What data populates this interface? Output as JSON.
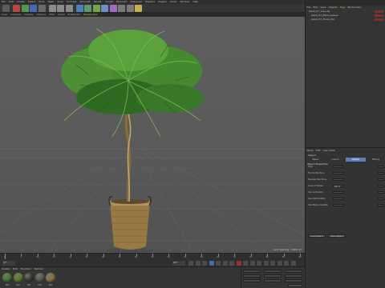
{
  "menubar": {
    "items": [
      "File",
      "Edit",
      "Create",
      "Select",
      "Tools",
      "Mesh",
      "Snap",
      "Animate",
      "Simulate",
      "Render",
      "Sculpt",
      "MoGraph",
      "Character",
      "Pipeline",
      "Plugins",
      "Script",
      "Window",
      "Help"
    ]
  },
  "toolbar": {
    "buttons": [
      {
        "name": "undo-icon",
        "color": "#5c5c5c"
      },
      {
        "name": "x-axis-icon",
        "color": "#b54747"
      },
      {
        "name": "y-axis-icon",
        "color": "#4f9a4f"
      },
      {
        "name": "z-axis-icon",
        "color": "#4768b5"
      },
      {
        "name": "coord-system-icon",
        "color": "#6a6a6a"
      },
      {
        "name": "render-view-icon",
        "color": "#8a8a8a"
      },
      {
        "name": "render-picture-viewer-icon",
        "color": "#8a8a8a"
      },
      {
        "name": "render-settings-icon",
        "color": "#8a8a8a"
      },
      {
        "name": "cube-icon",
        "color": "#4a7ec2"
      },
      {
        "name": "pen-icon",
        "color": "#5a9a6a"
      },
      {
        "name": "subdivision-icon",
        "color": "#7aa24c"
      },
      {
        "name": "array-icon",
        "color": "#6c8fc4"
      },
      {
        "name": "deformer-icon",
        "color": "#a06bc0"
      },
      {
        "name": "scene-icon",
        "color": "#7a7a7a"
      },
      {
        "name": "camera-icon",
        "color": "#7a7a7a"
      },
      {
        "name": "light-icon",
        "color": "#c8b04a"
      }
    ]
  },
  "viewport": {
    "menu": [
      "View",
      "Cameras",
      "Display",
      "Options",
      "Filter",
      "Panel",
      "ProRender"
    ],
    "active_tab": "Perspective",
    "status": "Grid Spacing : 1000 cm"
  },
  "object_manager": {
    "menu": [
      "File",
      "Edit",
      "View",
      "Objects",
      "Tags",
      "Bookmarks"
    ],
    "active_menu": "Tags",
    "objects": [
      {
        "label": "plant_07_vray.obj"
      },
      {
        "label": "plant_07_Palm_Leaves"
      },
      {
        "label": "plant_07_Trunk_Pot"
      }
    ]
  },
  "attributes": {
    "menu": [
      "Mode",
      "Edit",
      "User Data"
    ],
    "title": "Object",
    "tabs": [
      "Basic",
      "Coord.",
      "Object",
      "Phong"
    ],
    "active_tab": "Object",
    "section": "Object Properties",
    "rows": [
      {
        "label": "Type",
        "value": ""
      },
      {
        "label": "Horizontal Price",
        "value": ""
      },
      {
        "label": "Preview Sub Price",
        "value": ""
      },
      {
        "label": "Level of Detail",
        "value": "100 %"
      },
      {
        "label": "Use Animation",
        "value": ""
      },
      {
        "label": "Use Deformation",
        "value": ""
      },
      {
        "label": "Use Motion Update",
        "value": ""
      }
    ],
    "buttons": [
      "Load Object",
      "Save Object"
    ]
  },
  "timeline": {
    "frames": [
      "0",
      "5",
      "10",
      "15",
      "20",
      "25",
      "30",
      "35",
      "40",
      "45",
      "50",
      "55",
      "60",
      "65",
      "70",
      "75",
      "80",
      "85",
      "90"
    ],
    "current": "0 F",
    "end": "90 F"
  },
  "materials": {
    "menu": [
      "Create",
      "Edit",
      "Function",
      "Texture"
    ],
    "swatches": [
      {
        "label": "Mat",
        "color": "#3f7a2d"
      },
      {
        "label": "Mat",
        "color": "#5b7d2a"
      },
      {
        "label": "Mat",
        "color": "#3a3a34"
      },
      {
        "label": "Mat",
        "color": "#5a5a50"
      },
      {
        "label": "Mat",
        "color": "#8a7042"
      }
    ]
  }
}
